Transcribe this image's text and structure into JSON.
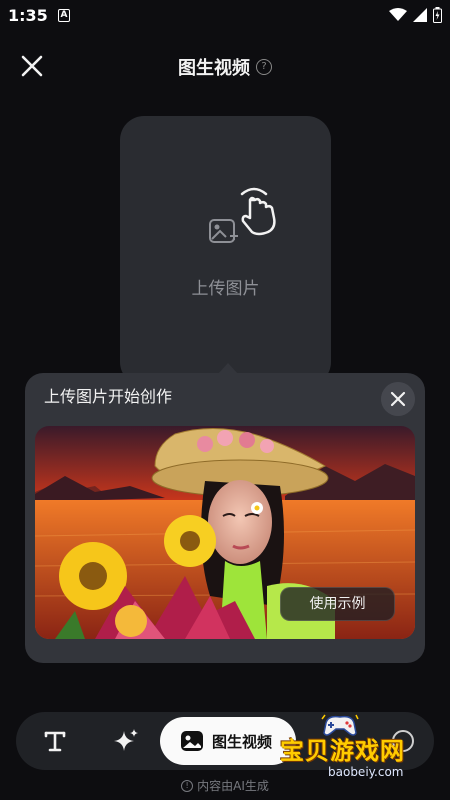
{
  "status": {
    "time": "1:35",
    "notif_letter": "A"
  },
  "header": {
    "title": "图生视频",
    "help_glyph": "?"
  },
  "upload": {
    "label": "上传图片"
  },
  "tip": {
    "title": "上传图片开始创作",
    "example_button": "使用示例"
  },
  "toolbar": {
    "active_label": "图生视频"
  },
  "footer": {
    "note": "内容由AI生成",
    "info_glyph": "!"
  },
  "watermark": {
    "text": "宝贝游戏网",
    "url": "baobeiy.com"
  },
  "colors": {
    "background": "#0d0d10",
    "card": "#2a2c31",
    "panel": "#33353b",
    "toolbar": "#202226",
    "active_tool": "#fafafa",
    "watermark": "#ffcc00"
  },
  "icons": {
    "close": "close-icon",
    "help": "question-icon",
    "upload": "image-add-tap-icon",
    "text_tool": "text-icon",
    "sparkle_tool": "sparkle-icon",
    "image_tool": "image-icon"
  }
}
